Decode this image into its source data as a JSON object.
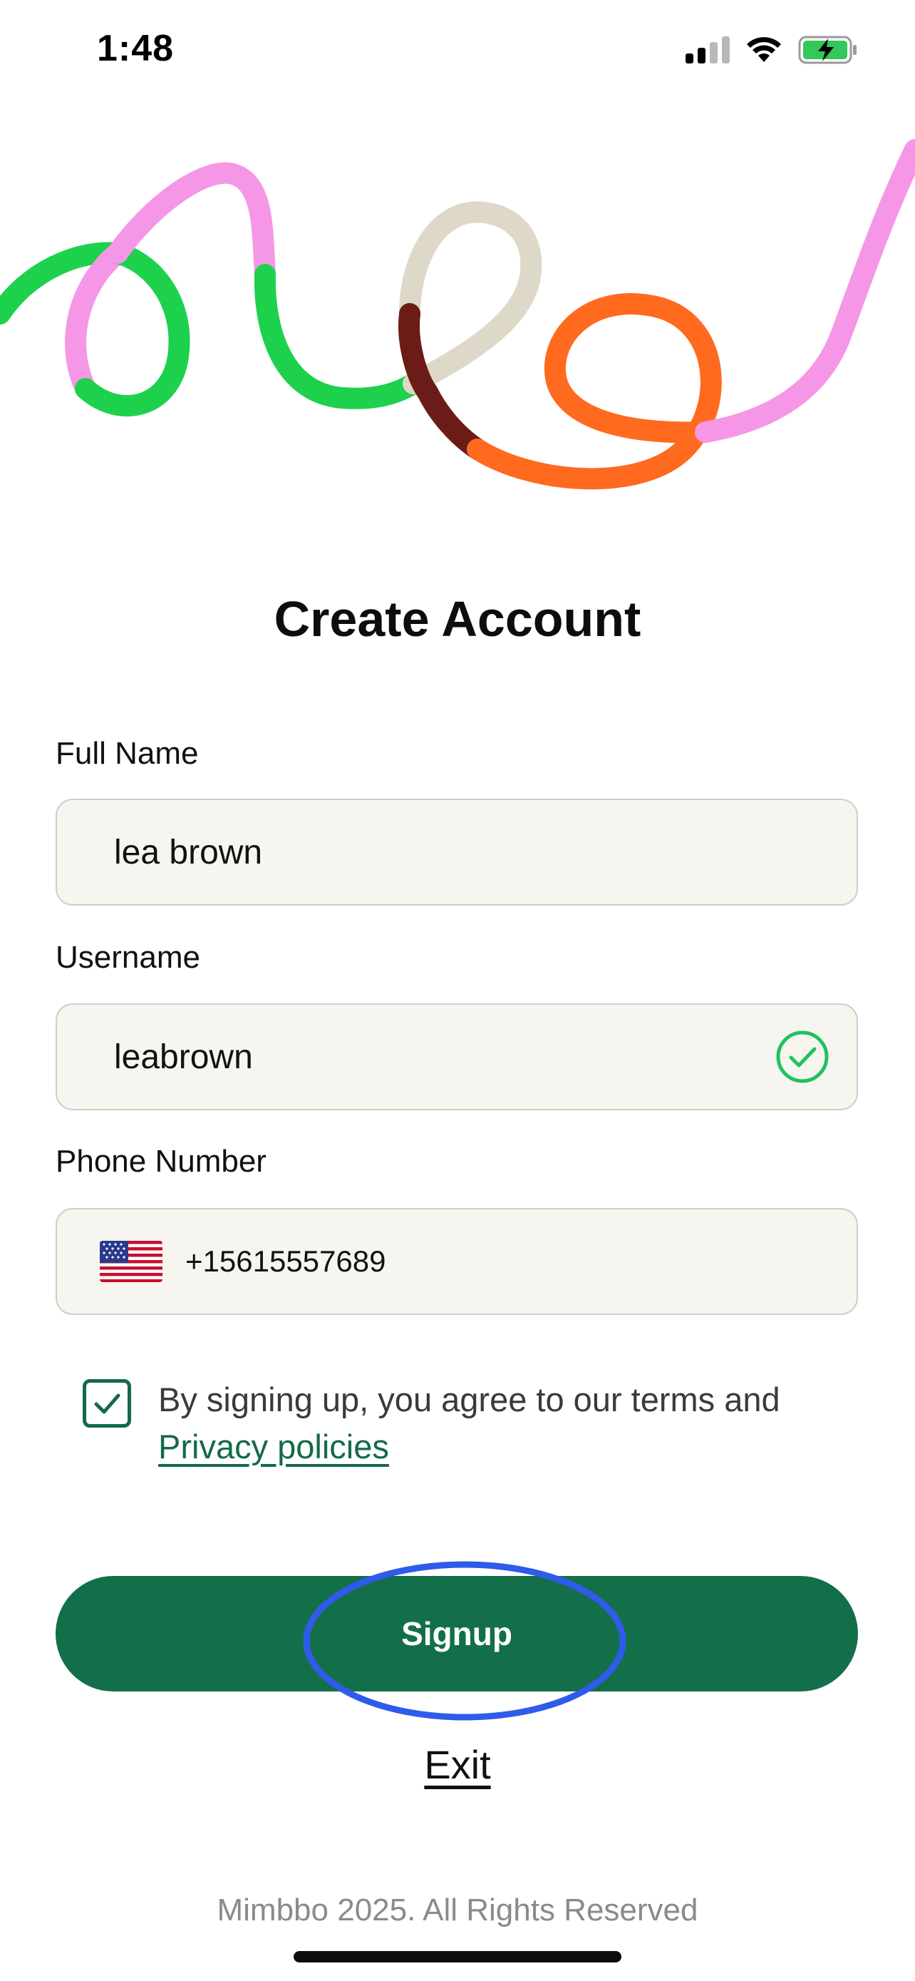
{
  "status_bar": {
    "time": "1:48",
    "icons": [
      "cellular-signal-icon",
      "wifi-icon",
      "battery-charging-icon"
    ]
  },
  "hero": {
    "icon": "squiggle-illustration"
  },
  "page": {
    "title": "Create Account"
  },
  "form": {
    "full_name": {
      "label": "Full Name",
      "value": "lea brown"
    },
    "username": {
      "label": "Username",
      "value": "leabrown",
      "valid_icon": "check-circle-icon"
    },
    "phone": {
      "label": "Phone Number",
      "value": "+15615557689",
      "country_flag": "us-flag-icon"
    }
  },
  "terms": {
    "checked": true,
    "text": "By signing up, you agree to our terms and",
    "link": "Privacy policies"
  },
  "actions": {
    "signup": "Signup",
    "exit": "Exit"
  },
  "footer": {
    "copyright": "Mimbbo 2025. All Rights Reserved"
  },
  "colors": {
    "primary": "#136f4a",
    "field_bg": "#f7f5f0",
    "valid": "#1fc35c",
    "highlight_ring": "#2f5bea"
  }
}
